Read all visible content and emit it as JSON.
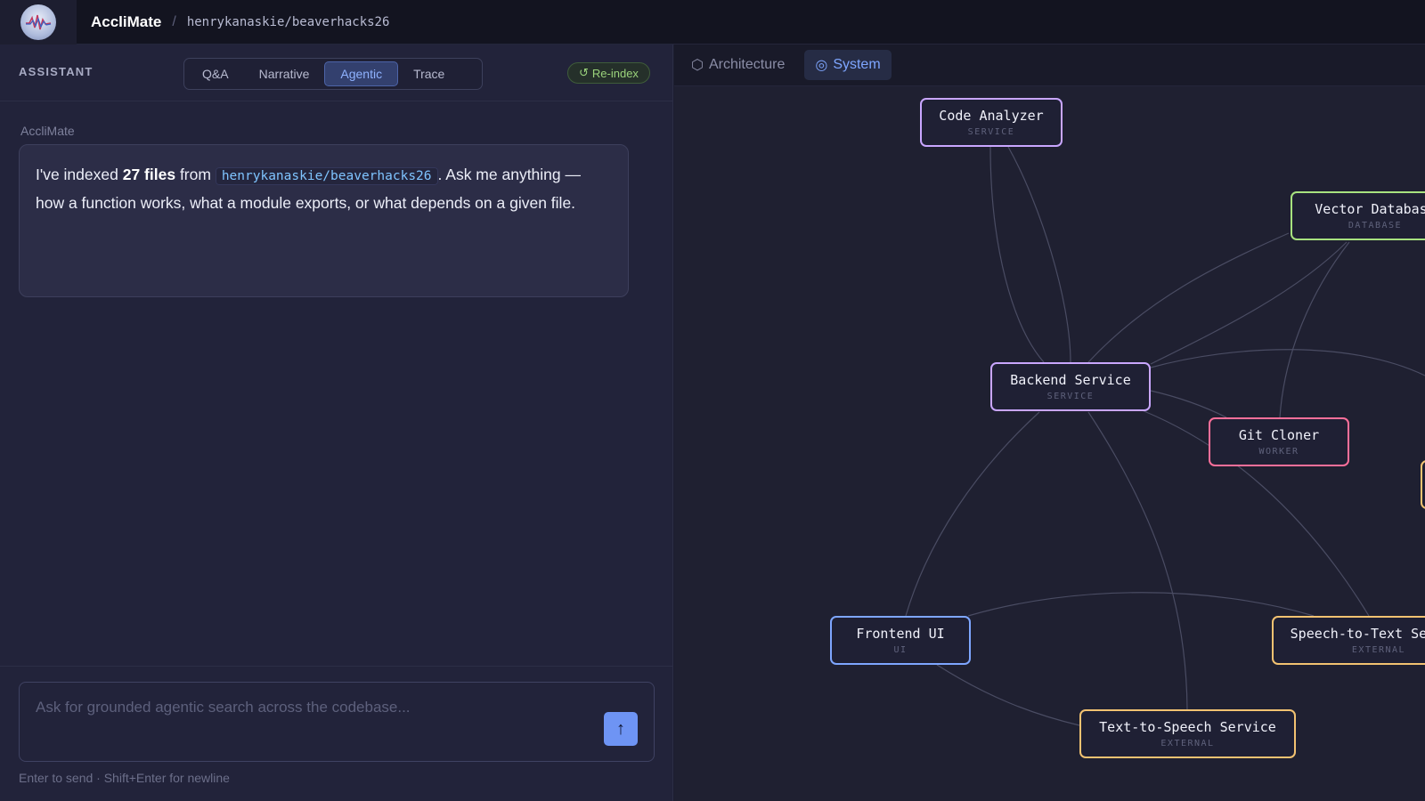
{
  "header": {
    "brand": "AccliMate",
    "separator": "/",
    "repo": "henrykanaskie/beaverhacks26"
  },
  "assistant": {
    "label": "ASSISTANT",
    "tabs": [
      {
        "label": "Q&A",
        "active": false
      },
      {
        "label": "Narrative",
        "active": false
      },
      {
        "label": "Agentic",
        "active": true
      },
      {
        "label": "Trace",
        "active": false
      }
    ],
    "reindex_label": "Re-index",
    "message": {
      "author": "AccliMate",
      "text_1": "I've indexed ",
      "file_count": "27 files",
      "text_2": " from ",
      "repo_chip": "henrykanaskie/beaverhacks26",
      "text_3": ". Ask me anything — how a function works, what a module exports, or what depends on a given file."
    },
    "input_placeholder": "Ask for grounded agentic search across the codebase...",
    "send_icon": "arrow-up-icon",
    "hint": "Enter to send · Shift+Enter for newline"
  },
  "view_tabs": [
    {
      "label": "Architecture",
      "icon": "hexagon-icon",
      "active": false
    },
    {
      "label": "System",
      "icon": "target-icon",
      "active": true
    }
  ],
  "graph": {
    "nodes": [
      {
        "id": "code-analyzer",
        "name": "Code Analyzer",
        "type": "SERVICE",
        "color": "#c9a6ff"
      },
      {
        "id": "vector-database",
        "name": "Vector Database",
        "type": "DATABASE",
        "color": "#a7e27f"
      },
      {
        "id": "backend-service",
        "name": "Backend Service",
        "type": "SERVICE",
        "color": "#c9a6ff"
      },
      {
        "id": "git-cloner",
        "name": "Git Cloner",
        "type": "WORKER",
        "color": "#ff6f9a"
      },
      {
        "id": "frontend-ui",
        "name": "Frontend UI",
        "type": "UI",
        "color": "#7ea6ff"
      },
      {
        "id": "speech-to-text",
        "name": "Speech-to-Text Service",
        "type": "EXTERNAL",
        "color": "#f2c271"
      },
      {
        "id": "text-to-speech",
        "name": "Text-to-Speech Service",
        "type": "EXTERNAL",
        "color": "#f2c271"
      }
    ]
  },
  "colors": {
    "accent": "#6e94f4",
    "reindex": "#9ad27b",
    "edge": "#4a4c63"
  }
}
